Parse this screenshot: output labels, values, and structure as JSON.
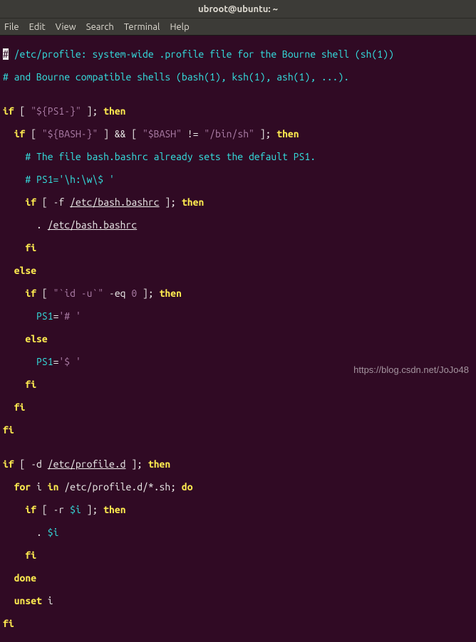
{
  "title": "ubroot@ubuntu: ~",
  "menu": {
    "file": "File",
    "edit": "Edit",
    "view": "View",
    "search": "Search",
    "terminal": "Terminal",
    "help": "Help"
  },
  "code": {
    "l1a": "#",
    "l1b": " /etc/profile: system-wide .profile file for the Bourne shell (sh(1))",
    "l2": "# and Bourne compatible shells (bash(1), ksh(1), ash(1), ...).",
    "l3": "",
    "l4_if": "if",
    "l4_rest": " [ ",
    "l4_str": "\"${PS1-}\"",
    "l4_rest2": " ]; ",
    "l4_then": "then",
    "l5_sp": "  ",
    "l5_if": "if",
    "l5_a": " [ ",
    "l5_s1": "\"${BASH-}\"",
    "l5_b": " ] && [ ",
    "l5_s2": "\"$BASH\"",
    "l5_c": " != ",
    "l5_s3": "\"/bin/sh\"",
    "l5_d": " ]; ",
    "l5_then": "then",
    "l6": "    # The file bash.bashrc already sets the default PS1.",
    "l7": "    # PS1='\\h:\\w\\$ '",
    "l8_sp": "    ",
    "l8_if": "if",
    "l8_a": " [ -f ",
    "l8_path": "/etc/bash.bashrc",
    "l8_b": " ]; ",
    "l8_then": "then",
    "l9_sp": "      . ",
    "l9_path": "/etc/bash.bashrc",
    "l10_sp": "    ",
    "l10_fi": "fi",
    "l11_sp": "  ",
    "l11_else": "else",
    "l12_sp": "    ",
    "l12_if": "if",
    "l12_a": " [ ",
    "l12_s": "\"`id -u`\"",
    "l12_b": " -eq ",
    "l12_n": "0",
    "l12_c": " ]; ",
    "l12_then": "then",
    "l13_sp": "      ",
    "l13_var": "PS1",
    "l13_eq": "=",
    "l13_s": "'# '",
    "l14_sp": "    ",
    "l14_else": "else",
    "l15_sp": "      ",
    "l15_var": "PS1",
    "l15_eq": "=",
    "l15_s": "'$ '",
    "l16_sp": "    ",
    "l16_fi": "fi",
    "l17_sp": "  ",
    "l17_fi": "fi",
    "l18_fi": "fi",
    "l19": "",
    "l20_if": "if",
    "l20_a": " [ -d ",
    "l20_path": "/etc/profile.d",
    "l20_b": " ]; ",
    "l20_then": "then",
    "l21_sp": "  ",
    "l21_for": "for",
    "l21_a": " i ",
    "l21_in": "in",
    "l21_b": " /etc/profile.d/*.sh; ",
    "l21_do": "do",
    "l22_sp": "    ",
    "l22_if": "if",
    "l22_a": " [ -r ",
    "l22_v": "$i",
    "l22_b": " ]; ",
    "l22_then": "then",
    "l23_sp": "      . ",
    "l23_v": "$i",
    "l24_sp": "    ",
    "l24_fi": "fi",
    "l25_sp": "  ",
    "l25_done": "done",
    "l26_sp": "  ",
    "l26_unset": "unset",
    "l26_a": " i",
    "l27_fi": "fi"
  },
  "watermark": "https://blog.csdn.net/JoJo48"
}
